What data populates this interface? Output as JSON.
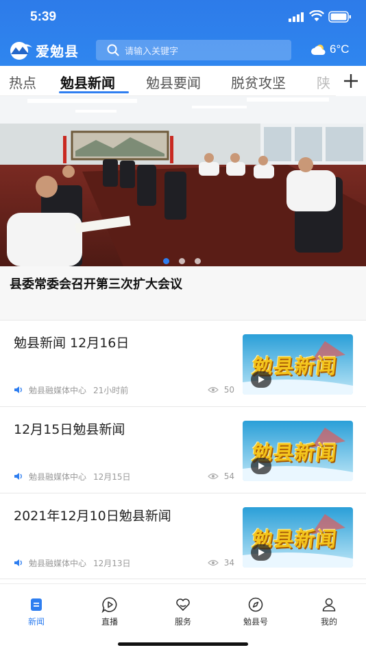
{
  "status_bar": {
    "time": "5:39"
  },
  "header": {
    "app_name": "爱勉县",
    "search_placeholder": "请输入关键字",
    "temperature": "6°C"
  },
  "tabs": [
    {
      "label": "热点",
      "active": false
    },
    {
      "label": "勉县新闻",
      "active": true
    },
    {
      "label": "勉县要闻",
      "active": false
    },
    {
      "label": "脱贫攻坚",
      "active": false
    },
    {
      "label": "陕",
      "active": false
    }
  ],
  "banner": {
    "caption": "县委常委会召开第三次扩大会议",
    "slide_count": 3,
    "active_slide": 1
  },
  "news": [
    {
      "title": "勉县新闻 12月16日",
      "source": "勉县融媒体中心",
      "time": "21小时前",
      "views": "50",
      "thumb_text": "勉县新闻"
    },
    {
      "title": "12月15日勉县新闻",
      "source": "勉县融媒体中心",
      "time": "12月15日",
      "views": "54",
      "thumb_text": "勉县新闻"
    },
    {
      "title": "2021年12月10日勉县新闻",
      "source": "勉县融媒体中心",
      "time": "12月13日",
      "views": "34",
      "thumb_text": "勉县新闻"
    }
  ],
  "tabbar": [
    {
      "label": "新闻",
      "icon": "news-icon",
      "active": true
    },
    {
      "label": "直播",
      "icon": "live-icon",
      "active": false
    },
    {
      "label": "服务",
      "icon": "service-icon",
      "active": false
    },
    {
      "label": "勉县号",
      "icon": "compass-icon",
      "active": false
    },
    {
      "label": "我的",
      "icon": "profile-icon",
      "active": false
    }
  ],
  "colors": {
    "brand": "#2e7ef0",
    "header": "#2f82ec"
  }
}
